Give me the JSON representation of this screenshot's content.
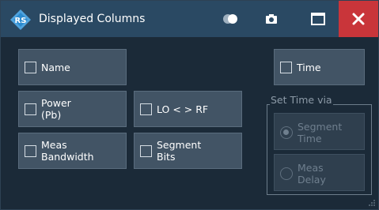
{
  "window": {
    "title": "Displayed Columns",
    "icons": {
      "logo": "rohde-schwarz-logo-icon",
      "toggle": "toggle-icon",
      "screenshot": "camera-icon",
      "maximize": "maximize-icon",
      "close": "close-icon"
    }
  },
  "columns": {
    "name": "Name",
    "power": "Power\n(Pb)",
    "lo_rf": "LO < > RF",
    "meas_bw": "Meas\nBandwidth",
    "segment_bits": "Segment\nBits",
    "time": "Time"
  },
  "set_time": {
    "label": "Set Time via",
    "segment_time": "Segment\nTime",
    "meas_delay": "Meas\nDelay",
    "selected": "segment_time"
  },
  "colors": {
    "accent": "#2a4963",
    "close": "#c9353a",
    "background": "#1b2a38",
    "button": "#425465"
  }
}
